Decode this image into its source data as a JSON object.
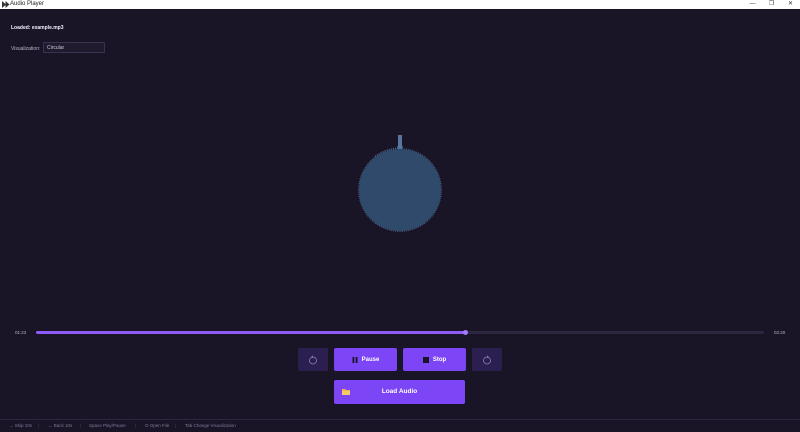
{
  "window": {
    "title": "Audio Player",
    "controls": [
      "—",
      "❐",
      "✕"
    ]
  },
  "header": {
    "loaded_text": "Loaded: example.mp3"
  },
  "visualization": {
    "label": "Visualization:",
    "selected": "Circular",
    "color": "#2f4a6b",
    "accent": "#5577a1"
  },
  "playback": {
    "current_time": "01:23",
    "total_time": "02:20",
    "progress": 0.59,
    "accent": "#8d5cf6"
  },
  "controls": {
    "back_icon": "rewind-10-icon",
    "pause_label": "Pause",
    "stop_label": "Stop",
    "forward_icon": "forward-10-icon",
    "load_label": "Load Audio",
    "load_icon": "folder-icon",
    "button_color": "#7c45f5"
  },
  "statusbar": {
    "items": [
      "→ Skip 10s",
      "← Back 10s",
      "Space Play/Pause",
      "O Open File",
      "Tab Change Visualization"
    ]
  }
}
